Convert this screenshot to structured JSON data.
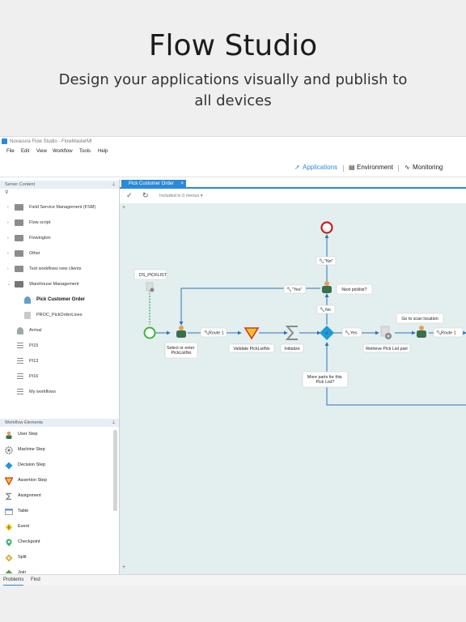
{
  "hero": {
    "title": "Flow Studio",
    "subtitle": "Design your applications visually and publish to all devices"
  },
  "window": {
    "title": "Novacura Flow Studio - FlowMasterMI",
    "menu": [
      "File",
      "Edit",
      "View",
      "Workflow",
      "Tools",
      "Help"
    ],
    "nav": [
      {
        "label": "Applications",
        "icon": "rocket-icon",
        "active": true
      },
      {
        "label": "Environment",
        "icon": "server-icon",
        "active": false
      },
      {
        "label": "Monitoring",
        "icon": "pulse-icon",
        "active": false
      }
    ]
  },
  "server_content": {
    "header": "Server Content",
    "search_icon": "search-icon",
    "items": [
      {
        "label": "Field Service Management (FSM)",
        "icon": "folder-icon",
        "expandable": true
      },
      {
        "label": "Flow script",
        "icon": "folder-icon",
        "expandable": true
      },
      {
        "label": "Flowington",
        "icon": "folder-icon",
        "expandable": true
      },
      {
        "label": "Other",
        "icon": "folder-icon",
        "expandable": true
      },
      {
        "label": "Test workflows new clients",
        "icon": "folder-icon",
        "expandable": true
      },
      {
        "label": "Warehouse Management",
        "icon": "folder-open-icon",
        "expandable": true,
        "expanded": true
      },
      {
        "label": "Pick Customer Order",
        "icon": "user-workflow-icon",
        "child": true,
        "selected": true
      },
      {
        "label": "PROC_PickOrderLines",
        "icon": "document-icon",
        "child": true
      },
      {
        "label": "Arrival",
        "icon": "user-workflow-icon"
      },
      {
        "label": "PI15",
        "icon": "list-icon"
      },
      {
        "label": "PI13",
        "icon": "list-icon"
      },
      {
        "label": "PI16",
        "icon": "list-icon"
      },
      {
        "label": "My workflows",
        "icon": "list-icon"
      }
    ]
  },
  "workflow_elements": {
    "header": "Workflow Elements",
    "items": [
      {
        "label": "User Step",
        "icon": "user-step-icon"
      },
      {
        "label": "Machine Step",
        "icon": "machine-step-icon"
      },
      {
        "label": "Decision Step",
        "icon": "decision-step-icon"
      },
      {
        "label": "Assertion Step",
        "icon": "assertion-step-icon"
      },
      {
        "label": "Assignment",
        "icon": "assignment-icon"
      },
      {
        "label": "Table",
        "icon": "table-icon"
      },
      {
        "label": "Event",
        "icon": "event-icon"
      },
      {
        "label": "Checkpoint",
        "icon": "checkpoint-icon"
      },
      {
        "label": "Split",
        "icon": "split-icon"
      },
      {
        "label": "Join",
        "icon": "join-icon"
      }
    ]
  },
  "bottom_tabs": [
    "Problems",
    "Find"
  ],
  "document": {
    "tab": "Pick Customer Order",
    "toolbar": {
      "menus_text": "Included in 0 menus"
    }
  },
  "diagram": {
    "nodes": {
      "ds_picklist": "DS_PICKLIST",
      "select_pick_list": "Select or enter PickListNo",
      "validate": "Validate PickListNo",
      "initialize": "Initialize",
      "retrieve": "Retrieve Pick List part",
      "go_scan": "Go to scan location",
      "next_picklist": "Next picklist?",
      "more_parts": "More parts for this Pick List?"
    },
    "edges": {
      "route1_a": "Route 1",
      "yes_right": "Yes",
      "route1_b": "Route 1",
      "no_up": "No",
      "no_top": "\"No\"",
      "yes_left": "\"Yes\""
    }
  }
}
